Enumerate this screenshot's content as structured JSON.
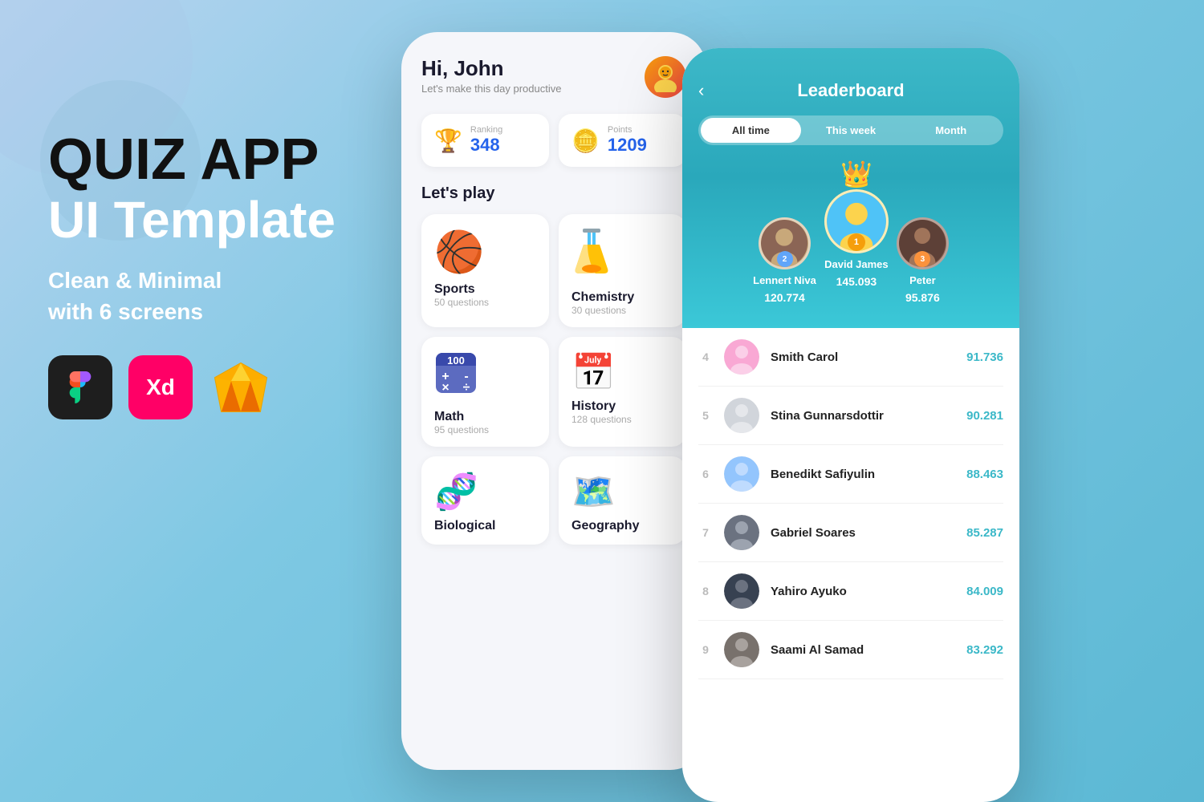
{
  "background": {
    "gradient_start": "#b8d4f0",
    "gradient_end": "#5bb8d4"
  },
  "left_section": {
    "title_line1": "QUIZ APP",
    "title_line2": "UI Template",
    "subtitle_line1": "Clean & Minimal",
    "subtitle_line2": "with 6 screens",
    "tools": [
      {
        "name": "Figma",
        "icon": "figma",
        "bg": "#1e1e1e"
      },
      {
        "name": "Adobe XD",
        "icon": "xd",
        "bg": "#ff0066"
      },
      {
        "name": "Sketch",
        "icon": "sketch",
        "bg": "transparent"
      }
    ]
  },
  "phone1": {
    "greeting": "Hi, John",
    "greeting_sub": "Let's make this day productive",
    "stats": {
      "ranking_label": "Ranking",
      "ranking_value": "348",
      "points_label": "Points",
      "points_value": "1209"
    },
    "section_title": "Let's play",
    "categories": [
      {
        "name": "Sports",
        "count": "50 questions",
        "emoji": "🏀"
      },
      {
        "name": "Chemistry",
        "count": "30 questions",
        "emoji": "🧪"
      },
      {
        "name": "Math",
        "count": "95 questions",
        "emoji": "🧮"
      },
      {
        "name": "History",
        "count": "128 questions",
        "emoji": "📅"
      },
      {
        "name": "Biological",
        "count": "",
        "emoji": "🧬"
      },
      {
        "name": "Geography",
        "count": "",
        "emoji": "🗺️"
      }
    ]
  },
  "phone2": {
    "title": "Leaderboard",
    "tabs": [
      {
        "label": "All time",
        "active": true
      },
      {
        "label": "This week",
        "active": false
      },
      {
        "label": "Month",
        "active": false
      }
    ],
    "top3": [
      {
        "rank": 2,
        "name": "Lennert Niva",
        "score": "120.774",
        "emoji": "👤"
      },
      {
        "rank": 1,
        "name": "David James",
        "score": "145.093",
        "emoji": "👦",
        "has_crown": true
      },
      {
        "rank": 3,
        "name": "Peter",
        "score": "95.876",
        "emoji": "👤"
      }
    ],
    "leaderboard": [
      {
        "rank": 4,
        "name": "Smith Carol",
        "score": "91.736",
        "emoji": "👩"
      },
      {
        "rank": 5,
        "name": "Stina Gunnarsdottir",
        "score": "90.281",
        "emoji": "👩"
      },
      {
        "rank": 6,
        "name": "Benedikt Safiyulin",
        "score": "88.463",
        "emoji": "👨"
      },
      {
        "rank": 7,
        "name": "Gabriel Soares",
        "score": "85.287",
        "emoji": "👨"
      },
      {
        "rank": 8,
        "name": "Yahiro Ayuko",
        "score": "84.009",
        "emoji": "👤"
      },
      {
        "rank": 9,
        "name": "Saami Al Samad",
        "score": "83.292",
        "emoji": "👨"
      }
    ]
  }
}
